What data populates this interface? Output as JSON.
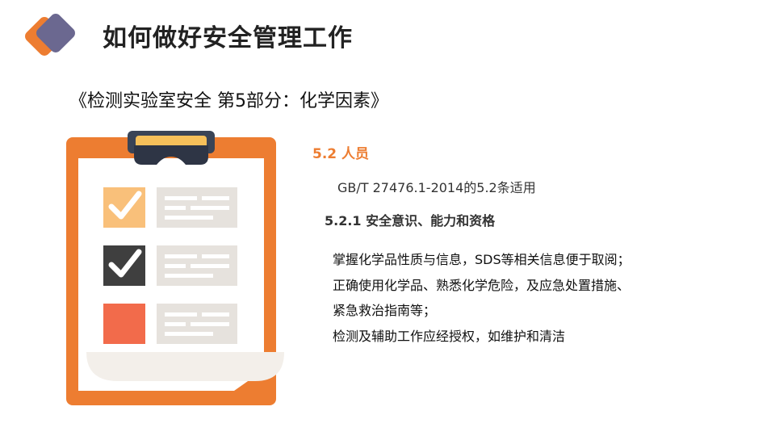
{
  "header": {
    "title": "如何做好安全管理工作",
    "subtitle": "《检测实验室安全 第5部分：化学因素》"
  },
  "content": {
    "section_heading": "5.2 人员",
    "section_note": "GB/T 27476.1-2014的5.2条适用",
    "subsection_heading": "5.2.1 安全意识、能力和资格",
    "lines": [
      "掌握化学品性质与信息，SDS等相关信息便于取阅；",
      "正确使用化学品、熟悉化学危险，及应急处置措施、",
      "紧急救治指南等；",
      "检测及辅助工作应经授权，如维护和清洁"
    ]
  },
  "colors": {
    "accent_orange": "#ED7D31",
    "logo_purple": "#6B6890",
    "checkbox_light": "#F9C07A",
    "checkbox_dark": "#3F3F3F",
    "checkbox_red": "#F26B4B"
  },
  "icons": {
    "logo": "diamond-logo-icon",
    "illustration": "clipboard-checklist-icon"
  }
}
